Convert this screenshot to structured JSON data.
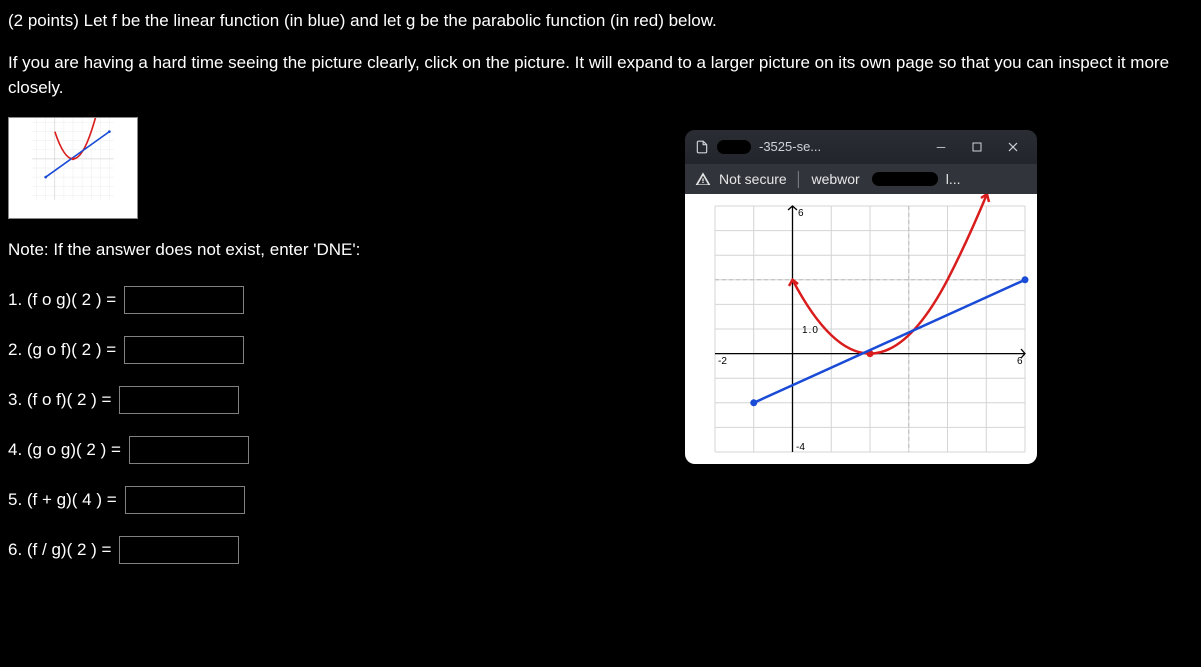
{
  "points": "(2 points)",
  "prompt_main": "Let f be the linear function (in blue) and let g be the parabolic function (in red) below.",
  "prompt_help": "If you are having a hard time seeing the picture clearly, click on the picture. It will expand to a larger picture on its own page so that you can inspect it more closely.",
  "note": "Note: If the answer does not exist, enter 'DNE':",
  "answers": [
    {
      "label": "1. (f o g)( 2 ) ="
    },
    {
      "label": "2. (g o f)( 2 ) ="
    },
    {
      "label": "3. (f o f)( 2 ) ="
    },
    {
      "label": "4. (g o g)( 2 ) ="
    },
    {
      "label": "5. (f + g)( 4 ) ="
    },
    {
      "label": "6. (f / g)( 2 ) ="
    }
  ],
  "popup": {
    "title_fragment": "-3525-se...",
    "not_secure": "Not secure",
    "addr_fragment": "webwor",
    "addr_trailing": "l..."
  },
  "chart_data": {
    "type": "line",
    "xlim": [
      -2,
      6
    ],
    "ylim": [
      -4,
      6
    ],
    "grid": true,
    "tick_labels": {
      "x": [
        -2,
        6
      ],
      "y": [
        -4,
        "1.0"
      ]
    },
    "series": [
      {
        "name": "f (linear, blue)",
        "color": "#1a4bd6",
        "type": "line",
        "endpoints_style": "dots",
        "points": [
          [
            -1.0,
            -2.0
          ],
          [
            6.0,
            3.0
          ]
        ],
        "note": "f(x) ≈ (5/7)x − 9/7; f(2)≈0.14, f(4)≈1.57"
      },
      {
        "name": "g (parabolic, red)",
        "color": "#d91c1c",
        "type": "curve",
        "vertex": [
          2.0,
          0.0
        ],
        "opens": "up",
        "sample_points": [
          [
            0,
            3
          ],
          [
            1,
            0.75
          ],
          [
            2,
            0
          ],
          [
            3,
            0.75
          ],
          [
            4,
            3
          ],
          [
            5,
            6.5
          ]
        ],
        "note": "g(x) ≈ 0.75(x−2)^2; g(2)=0, g(4)≈3"
      }
    ]
  }
}
